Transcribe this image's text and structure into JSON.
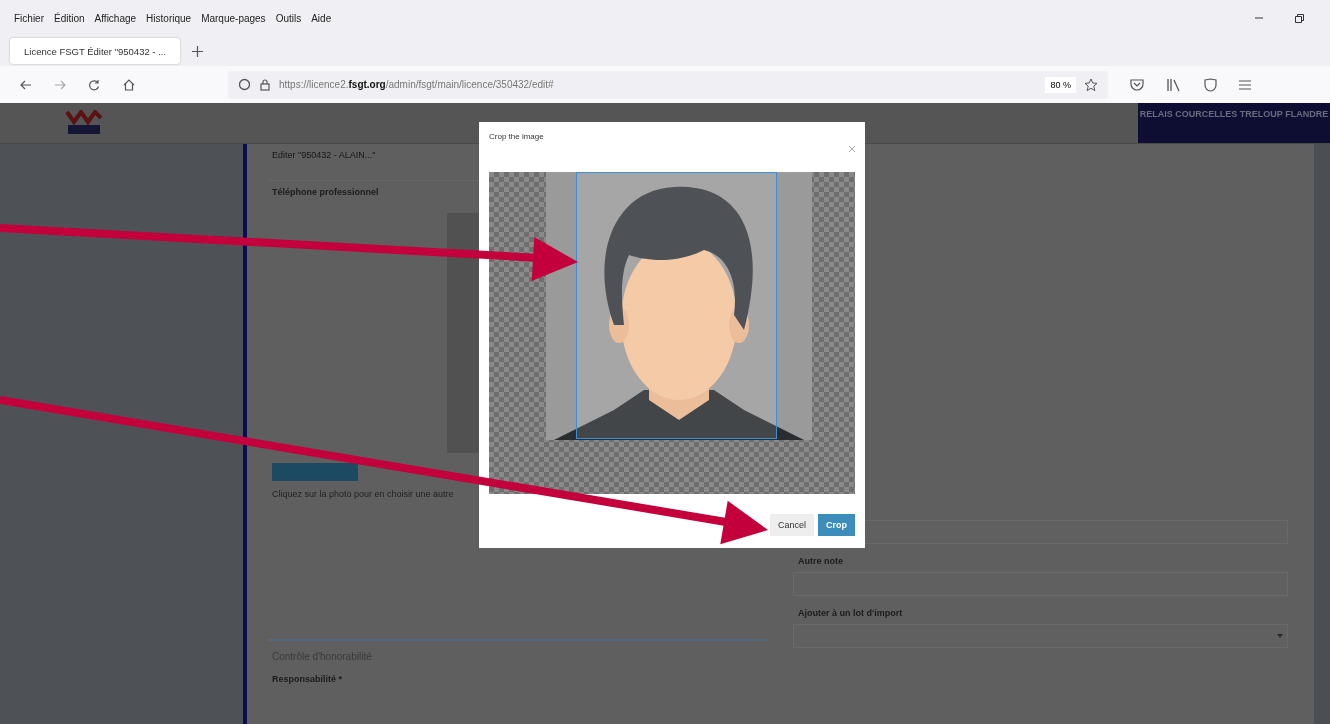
{
  "menu_bar": [
    "Fichier",
    "Édition",
    "Affichage",
    "Historique",
    "Marque-pages",
    "Outils",
    "Aide"
  ],
  "tabs": [
    {
      "title": "Licence FSGT Éditer \"950432 - ...",
      "selected": true
    }
  ],
  "address_bar": {
    "url": "https://licence2.**fsgt.org**/admin/fsgt/main/licence/350432/edit#",
    "zoom": "80 %"
  },
  "header": {
    "club": "RELAIS COURCELLES TRELOUP FLANDRE"
  },
  "left_panel": {
    "title": "Editer \"950432 - ALAIN...\"",
    "field_label": "Téléphone professionnel",
    "photo_hint": "Cliquez sur la photo pour en choisir une autre",
    "section": "Contrôle d'honorabilité",
    "responsibility_label": "Responsabilité *"
  },
  "right_panel": {
    "fields": [
      {
        "label": "Autre note",
        "kind": "text"
      },
      {
        "label": "Ajouter à un lot d'import",
        "kind": "select"
      }
    ]
  },
  "modal": {
    "title": "Crop the image",
    "buttons": [
      {
        "label": "Cancel",
        "kind": "secondary"
      },
      {
        "label": "Crop",
        "kind": "primary"
      }
    ]
  }
}
